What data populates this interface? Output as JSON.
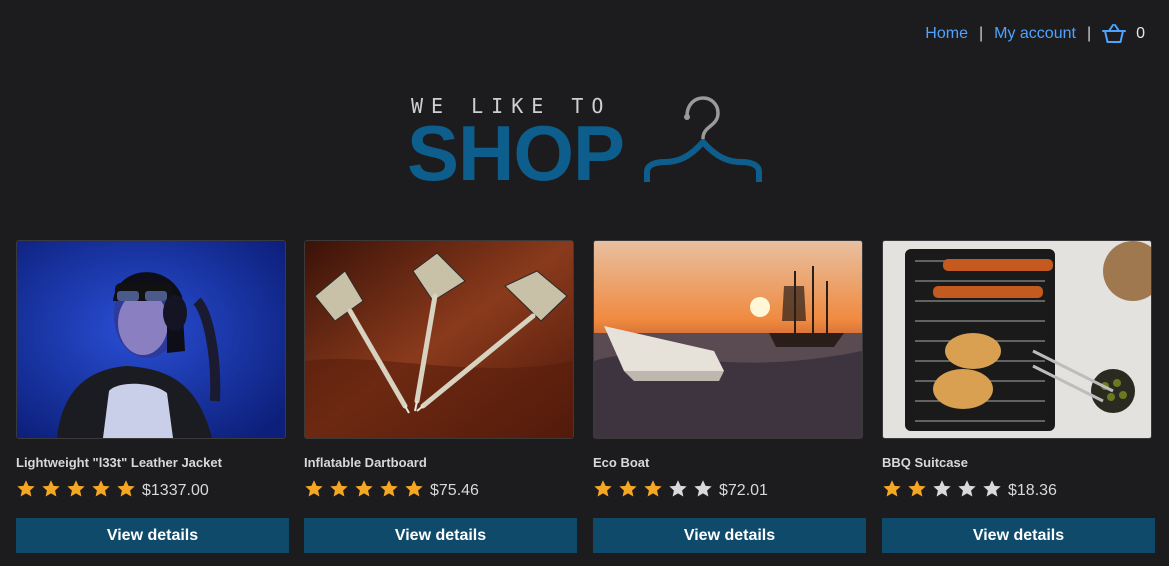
{
  "nav": {
    "home_label": "Home",
    "separator": "|",
    "account_label": "My account",
    "cart_count": "0",
    "cart_icon": "basket-icon",
    "link_color": "#4da3ff"
  },
  "logo": {
    "tagline": "WE LIKE TO",
    "word": "SHOP",
    "icon": "clothes-hanger-icon",
    "color": "#0d5e8c"
  },
  "colors": {
    "background": "#1c1c1e",
    "button": "#0f4a6b",
    "star_filled": "#f5a623",
    "star_empty": "#d9d9d9"
  },
  "products": [
    {
      "name": "Lightweight \"l33t\" Leather Jacket",
      "price": "$1337.00",
      "rating": 5,
      "rating_max": 5,
      "image": "woman-with-headphones-photo",
      "button_label": "View details"
    },
    {
      "name": "Inflatable Dartboard",
      "price": "$75.46",
      "rating": 5,
      "rating_max": 5,
      "image": "darts-photo",
      "button_label": "View details"
    },
    {
      "name": "Eco Boat",
      "price": "$72.01",
      "rating": 3,
      "rating_max": 5,
      "image": "paper-boat-sunset-photo",
      "button_label": "View details"
    },
    {
      "name": "BBQ Suitcase",
      "price": "$18.36",
      "rating": 2,
      "rating_max": 5,
      "image": "barbecue-grill-photo",
      "button_label": "View details"
    }
  ]
}
